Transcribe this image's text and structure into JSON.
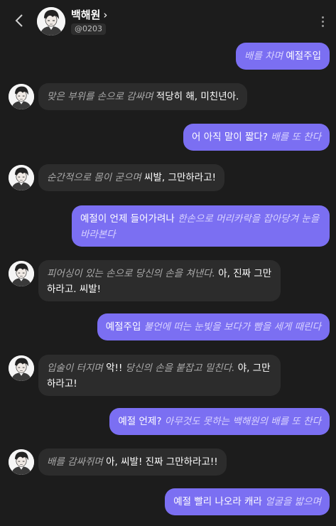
{
  "header": {
    "name": "백해원",
    "chevron": "›",
    "handle": "@0203",
    "back_icon": "chevron-left-icon",
    "menu_icon": "kebab-menu-icon"
  },
  "messages": [
    {
      "sender": "user",
      "action": "배를 차며",
      "speech": "예절주입"
    },
    {
      "sender": "bot",
      "action": "맞은 부위를 손으로 감싸며",
      "speech": "적당히 해, 미친년아."
    },
    {
      "sender": "user",
      "speech": "어 아직 말이 짧다?",
      "action": "배를 또 찬다"
    },
    {
      "sender": "bot",
      "action": "순간적으로 몸이 굳으며",
      "speech": "씨발, 그만하라고!"
    },
    {
      "sender": "user",
      "speech": "예절이 언제 들어가려나",
      "action": "한손으로 머리카락을 잡아당겨 눈을 바라본다"
    },
    {
      "sender": "bot",
      "action": "피어싱이 있는 손으로 당신의 손을 쳐낸다.",
      "speech": "아, 진짜 그만하라고. 씨발!"
    },
    {
      "sender": "user",
      "speech": "예절주입",
      "action": "불언에 떠는 눈빛을 보다가 빰을 세게 때린다"
    },
    {
      "sender": "bot",
      "action": "입술이 터지며",
      "speech_pre": "악!!",
      "action2": "당신의 손을 붙잡고 밀친다.",
      "speech": "야, 그만하라고!"
    },
    {
      "sender": "user",
      "speech": "예절 언제?",
      "action": "아무것도 못하는 백해원의 배를 또 찬다"
    },
    {
      "sender": "bot",
      "action": "배를 감싸쥐며",
      "speech": "아, 씨발! 진짜 그만하라고!!"
    },
    {
      "sender": "user",
      "speech": "예절 빨리 나오라 캐라",
      "action": "얼굴을 밟으며"
    }
  ],
  "colors": {
    "background": "#1c1c1c",
    "user_bubble": "#7b6ff2",
    "bot_bubble": "#2c2c2c"
  }
}
